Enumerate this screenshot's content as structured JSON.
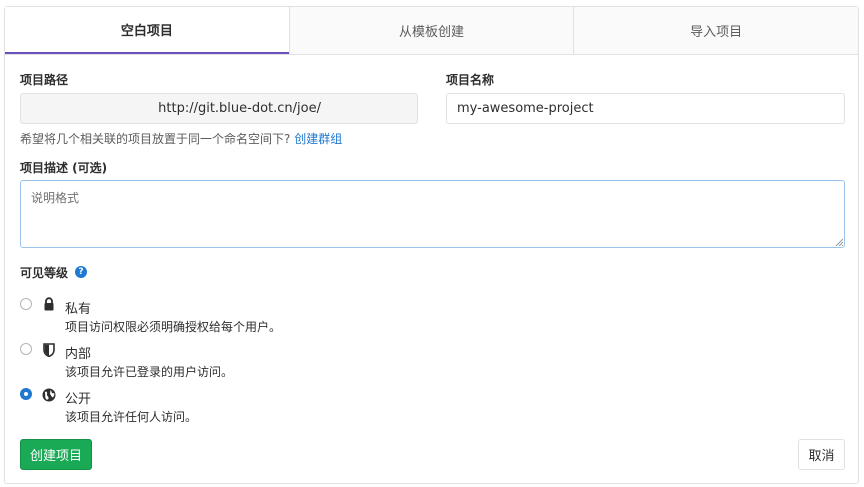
{
  "tabs": [
    {
      "label": "空白项目",
      "active": true
    },
    {
      "label": "从模板创建",
      "active": false
    },
    {
      "label": "导入项目",
      "active": false
    }
  ],
  "project_path": {
    "label": "项目路径",
    "value": "http://git.blue-dot.cn/joe/"
  },
  "project_name": {
    "label": "项目名称",
    "value": "my-awesome-project"
  },
  "namespace_help": {
    "text": "希望将几个相关联的项目放置于同一个命名空间下?",
    "link": "创建群组"
  },
  "description": {
    "label": "项目描述 (可选)",
    "placeholder": "说明格式"
  },
  "visibility": {
    "label": "可见等级",
    "help_icon": "question-circle-icon",
    "options": [
      {
        "icon": "lock-icon",
        "title": "私有",
        "desc": "项目访问权限必须明确授权给每个用户。",
        "checked": false
      },
      {
        "icon": "shield-icon",
        "title": "内部",
        "desc": "该项目允许已登录的用户访问。",
        "checked": false
      },
      {
        "icon": "globe-icon",
        "title": "公开",
        "desc": "该项目允许任何人访问。",
        "checked": true
      }
    ]
  },
  "actions": {
    "create_label": "创建项目",
    "cancel_label": "取消"
  },
  "colors": {
    "accent": "#1f78d1",
    "tab_active_border": "#6b4fbb",
    "primary_button": "#1aaa55"
  }
}
